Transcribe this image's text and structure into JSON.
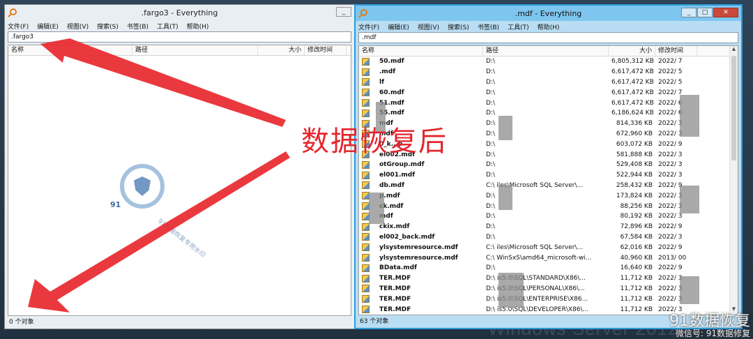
{
  "left_window": {
    "title": ".fargo3 - Everything",
    "menu": [
      "文件(F)",
      "编辑(E)",
      "视图(V)",
      "搜索(S)",
      "书签(B)",
      "工具(T)",
      "帮助(H)"
    ],
    "search_value": ".fargo3",
    "columns": [
      "名称",
      "路径",
      "大小",
      "修改时间"
    ],
    "status": "0 个对象"
  },
  "right_window": {
    "title": ".mdf - Everything",
    "menu": [
      "文件(F)",
      "编辑(E)",
      "视图(V)",
      "搜索(S)",
      "书签(B)",
      "工具(T)",
      "帮助(H)"
    ],
    "search_value": ".mdf",
    "columns": [
      "名称",
      "路径",
      "大小",
      "修改时间"
    ],
    "status": "63 个对象",
    "rows": [
      {
        "name": "50.mdf",
        "path": "D:\\",
        "size": "6,805,312 KB",
        "date": "2022/",
        "extra": "7"
      },
      {
        "name": ".mdf",
        "path": "D:\\",
        "size": "6,617,472 KB",
        "date": "2022/",
        "extra": "5"
      },
      {
        "name": "lf",
        "path": "D:\\",
        "size": "6,617,472 KB",
        "date": "2022/",
        "extra": "5"
      },
      {
        "name": "60.mdf",
        "path": "D:\\",
        "size": "6,617,472 KB",
        "date": "2022/",
        "extra": "7"
      },
      {
        "name": "51.mdf",
        "path": "D:\\",
        "size": "6,617,472 KB",
        "date": "2022/",
        "extra": "6"
      },
      {
        "name": "55.mdf",
        "path": "D:\\",
        "size": "6,186,624 KB",
        "date": "2022/",
        "extra": "6"
      },
      {
        "name": "mdf",
        "path": "D:\\",
        "size": "814,336 KB",
        "date": "2022/",
        "extra": "3"
      },
      {
        "name": "mdf",
        "path": "D:\\",
        "size": "672,960 KB",
        "date": "2022/",
        "extra": "3"
      },
      {
        "name": "0_k...p",
        "path": "D:\\",
        "size": "603,072 KB",
        "date": "2022/",
        "extra": "9"
      },
      {
        "name": "el002.mdf",
        "path": "D:\\",
        "size": "581,888 KB",
        "date": "2022/",
        "extra": "3"
      },
      {
        "name": "otGroup.mdf",
        "path": "D:\\",
        "size": "529,408 KB",
        "date": "2022/",
        "extra": "3"
      },
      {
        "name": "el001.mdf",
        "path": "D:\\",
        "size": "522,944 KB",
        "date": "2022/",
        "extra": "3"
      },
      {
        "name": "db.mdf",
        "path": "C:\\",
        "path2": "iles\\Microsoft SQL Server\\...",
        "size": "258,432 KB",
        "date": "2022/",
        "extra": "9"
      },
      {
        "name": "p.mdf",
        "path": "D:\\",
        "size": "173,824 KB",
        "date": "2022/",
        "extra": "3"
      },
      {
        "name": "ck.mdf",
        "path": "D:\\",
        "size": "88,256 KB",
        "date": "2022/",
        "extra": "3"
      },
      {
        "name": "mdf",
        "path": "D:\\",
        "size": "80,192 KB",
        "date": "2022/",
        "extra": "3"
      },
      {
        "name": "ckix.mdf",
        "path": "D:\\",
        "size": "72,896 KB",
        "date": "2022/",
        "extra": "9"
      },
      {
        "name": "el002_back.mdf",
        "path": "D:\\",
        "size": "67,584 KB",
        "date": "2022/",
        "extra": "3"
      },
      {
        "name": "ylsystemresource.mdf",
        "path": "C:\\",
        "path2": "iles\\Microsoft SQL Server\\...",
        "size": "62,016 KB",
        "date": "2022/",
        "extra": "9"
      },
      {
        "name": "ylsystemresource.mdf",
        "path": "C:\\",
        "path2": "WinSxS\\amd64_microsoft-wi...",
        "size": "40,960 KB",
        "date": "2013/",
        "extra": "00"
      },
      {
        "name": "BData.mdf",
        "path": "D:\\",
        "size": "16,640 KB",
        "date": "2022/",
        "extra": "9"
      },
      {
        "name": "TER.MDF",
        "path": "D:\\",
        "path2": "is5.0\\SQL\\STANDARD\\X86\\...",
        "size": "11,712 KB",
        "date": "2022/",
        "extra": "3"
      },
      {
        "name": "TER.MDF",
        "path": "D:\\",
        "path2": "is5.0\\SQL\\PERSONAL\\X86\\...",
        "size": "11,712 KB",
        "date": "2022/",
        "extra": "3"
      },
      {
        "name": "TER.MDF",
        "path": "D:\\",
        "path2": "is5.0\\SQL\\ENTERPRISE\\X86...",
        "size": "11,712 KB",
        "date": "2022/",
        "extra": "3"
      },
      {
        "name": "TER.MDF",
        "path": "D:\\",
        "path2": "is5.0\\SQL\\DEVELOPER\\X86\\...",
        "size": "11,712 KB",
        "date": "2022/",
        "extra": "3"
      }
    ]
  },
  "annotation": {
    "text": "数据恢复后",
    "color": "#e3262d"
  },
  "watermarks": {
    "logo_text": "91",
    "diagonal": "91数据恢复专用水印",
    "corner_main": "91数据恢复",
    "corner_sub": "微信号: 91数据修复"
  },
  "background_text": "Windows Server 2012"
}
